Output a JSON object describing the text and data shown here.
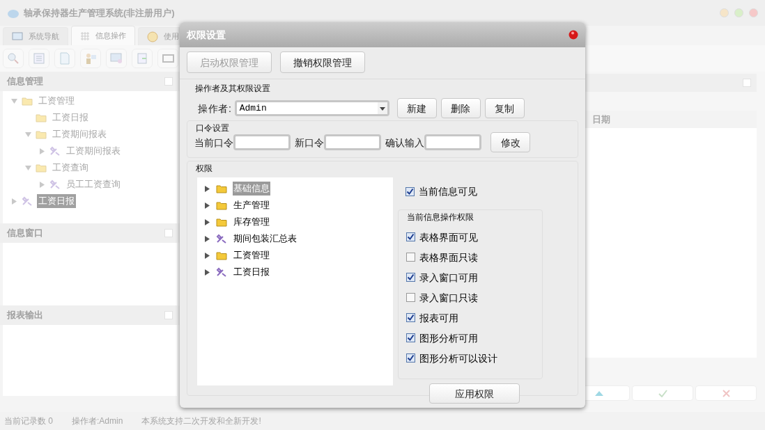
{
  "window": {
    "title": "轴承保持器生产管理系统(非注册用户)"
  },
  "tabs": [
    {
      "label": "系统导航",
      "selected": false,
      "kind": "monitor"
    },
    {
      "label": "信息操作",
      "selected": true,
      "kind": "grid"
    },
    {
      "label": "使用",
      "selected": false,
      "kind": "help"
    }
  ],
  "toolbar": [
    {
      "kind": "search"
    },
    {
      "kind": "list"
    },
    {
      "kind": "page"
    },
    {
      "kind": "user"
    },
    {
      "kind": "screen"
    },
    {
      "kind": "export"
    },
    {
      "kind": "window"
    }
  ],
  "sidebar": {
    "panels": [
      {
        "title": "信息管理",
        "kind": "tree",
        "tree": [
          {
            "label": "工资管理",
            "kind": "folder",
            "expanded": true,
            "selected": false,
            "children": [
              {
                "label": "工资日报",
                "kind": "folder",
                "selected": false
              },
              {
                "label": "工资期间报表",
                "kind": "folder",
                "expanded": true,
                "selected": false,
                "children": [
                  {
                    "label": "工资期间报表",
                    "kind": "tool",
                    "expanded": false,
                    "selected": false
                  }
                ]
              },
              {
                "label": "工资查询",
                "kind": "folder",
                "expanded": true,
                "selected": false,
                "children": [
                  {
                    "label": "员工工资查询",
                    "kind": "tool",
                    "expanded": false,
                    "selected": false
                  }
                ]
              }
            ]
          },
          {
            "label": "工资日报",
            "kind": "tool",
            "expanded": false,
            "selected": true
          }
        ]
      },
      {
        "title": "信息窗口",
        "kind": "empty"
      },
      {
        "title": "报表输出",
        "kind": "empty"
      }
    ]
  },
  "main": {
    "column_header": "日期",
    "buttons": [
      {
        "kind": "up"
      },
      {
        "kind": "ok"
      },
      {
        "kind": "cancel"
      }
    ]
  },
  "status_bar": [
    "当前记录数 0",
    "操作者:Admin",
    "本系统支持二次开发和全新开发!"
  ],
  "dialog": {
    "title": "权限设置",
    "mode_buttons": [
      {
        "label": "启动权限管理",
        "disabled": true
      },
      {
        "label": "撤销权限管理",
        "disabled": false
      }
    ],
    "operator_section": {
      "title": "操作者及其权限设置",
      "label": "操作者:",
      "value": "Admin",
      "buttons": [
        "新建",
        "删除",
        "复制"
      ]
    },
    "password_section": {
      "title": "口令设置",
      "fields": [
        "当前口令",
        "新口令",
        "确认输入"
      ],
      "button": "修改"
    },
    "permission_section": {
      "title": "权限",
      "tree": [
        {
          "label": "基础信息",
          "kind": "folder",
          "selected": true
        },
        {
          "label": "生产管理",
          "kind": "folder",
          "selected": false
        },
        {
          "label": "库存管理",
          "kind": "folder",
          "selected": false
        },
        {
          "label": "期间包装汇总表",
          "kind": "tool",
          "selected": false
        },
        {
          "label": "工资管理",
          "kind": "folder",
          "selected": false
        },
        {
          "label": "工资日报",
          "kind": "tool",
          "selected": false
        }
      ],
      "visible_option": {
        "label": "当前信息可见",
        "checked": true
      },
      "ops_title": "当前信息操作权限",
      "ops": [
        {
          "label": "表格界面可见",
          "checked": true
        },
        {
          "label": "表格界面只读",
          "checked": false
        },
        {
          "label": "录入窗口可用",
          "checked": true
        },
        {
          "label": "录入窗口只读",
          "checked": false
        },
        {
          "label": "报表可用",
          "checked": true
        },
        {
          "label": "图形分析可用",
          "checked": true
        },
        {
          "label": "图形分析可以设计",
          "checked": true
        }
      ],
      "apply_button": "应用权限"
    }
  }
}
